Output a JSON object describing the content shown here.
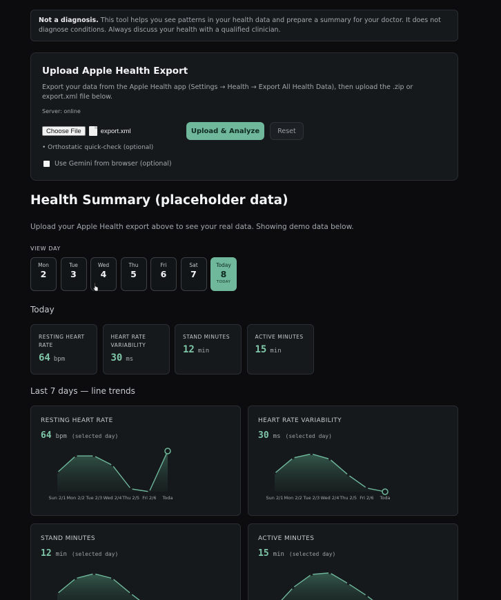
{
  "notice": {
    "bold": "Not a diagnosis.",
    "text": " This tool helps you see patterns in your health data and prepare a summary for your doctor. It does not diagnose conditions. Always discuss your health with a qualified clinician."
  },
  "upload": {
    "title": "Upload Apple Health Export",
    "description": "Export your data from the Apple Health app (Settings → Health → Export All Health Data), then upload the .zip or export.xml file below.",
    "server_status": "Server: online",
    "choose_file_label": "Choose File",
    "file_name": "export.xml",
    "analyze_label": "Upload & Analyze",
    "reset_label": "Reset",
    "orthostatic_label": "• Orthostatic quick-check (optional)",
    "gemini_label": "Use Gemini from browser (optional)"
  },
  "summary": {
    "title": "Health Summary (placeholder data)",
    "subtitle": "Upload your Apple Health export above to see your real data. Showing demo data below.",
    "view_day_label": "VIEW DAY"
  },
  "days": [
    {
      "name": "Mon",
      "num": "2"
    },
    {
      "name": "Tue",
      "num": "3"
    },
    {
      "name": "Wed",
      "num": "4"
    },
    {
      "name": "Thu",
      "num": "5"
    },
    {
      "name": "Fri",
      "num": "6"
    },
    {
      "name": "Sat",
      "num": "7"
    },
    {
      "name": "Today",
      "num": "8",
      "tag": "TODAY",
      "active": true
    }
  ],
  "today_label": "Today",
  "metrics": [
    {
      "label": "RESTING HEART RATE",
      "value": "64",
      "unit": "bpm"
    },
    {
      "label": "HEART RATE VARIABILITY",
      "value": "30",
      "unit": "ms"
    },
    {
      "label": "STAND MINUTES",
      "value": "12",
      "unit": "min"
    },
    {
      "label": "ACTIVE MINUTES",
      "value": "15",
      "unit": "min"
    }
  ],
  "trends_label": "Last 7 days — line trends",
  "selected_day_text": "(selected day)",
  "x_labels": [
    "Sun 2/1",
    "Mon 2/2",
    "Tue 2/3",
    "Wed 2/4",
    "Thu 2/5",
    "Fri 2/6",
    "Toda"
  ],
  "chart_data": [
    {
      "type": "area",
      "title": "RESTING HEART RATE",
      "value": "64",
      "unit": "bpm",
      "x": [
        "Sun 2/1",
        "Mon 2/2",
        "Tue 2/3",
        "Wed 2/4",
        "Thu 2/5",
        "Fri 2/6",
        "Toda"
      ],
      "values": [
        0.47,
        0.88,
        0.88,
        0.65,
        0.07,
        0.0,
        1.0
      ],
      "selected_index": 6
    },
    {
      "type": "area",
      "title": "HEART RATE VARIABILITY",
      "value": "30",
      "unit": "ms",
      "x": [
        "Sun 2/1",
        "Mon 2/2",
        "Tue 2/3",
        "Wed 2/4",
        "Thu 2/5",
        "Fri 2/6",
        "Toda"
      ],
      "values": [
        0.45,
        0.83,
        0.93,
        0.8,
        0.41,
        0.09,
        0.0
      ],
      "selected_index": 6
    },
    {
      "type": "area",
      "title": "STAND MINUTES",
      "value": "12",
      "unit": "min",
      "x": [
        "Sun 2/1",
        "Mon 2/2",
        "Tue 2/3",
        "Wed 2/4",
        "Thu 2/5",
        "Fri 2/6",
        "Toda"
      ],
      "values": [
        0.4,
        0.78,
        0.9,
        0.78,
        0.4,
        0.05,
        0.0
      ],
      "selected_index": 6
    },
    {
      "type": "area",
      "title": "ACTIVE MINUTES",
      "value": "15",
      "unit": "min",
      "x": [
        "Sun 2/1",
        "Mon 2/2",
        "Tue 2/3",
        "Wed 2/4",
        "Thu 2/5",
        "Fri 2/6",
        "Toda"
      ],
      "values": [
        0.05,
        0.55,
        0.88,
        0.92,
        0.65,
        0.35,
        0.0
      ],
      "selected_index": 6
    }
  ],
  "colors": {
    "accent": "#6fb89b",
    "background": "#0c0c0e",
    "card": "#16191c"
  }
}
